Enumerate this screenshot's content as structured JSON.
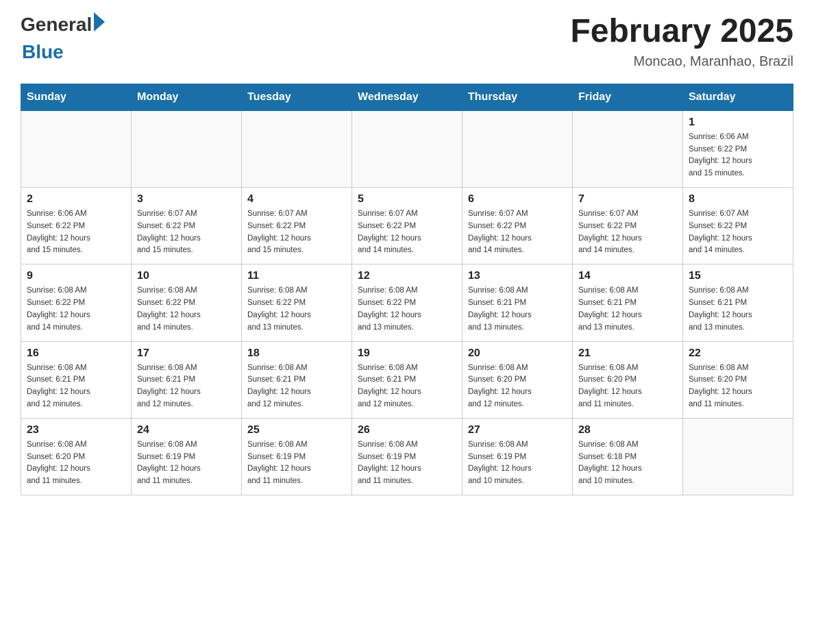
{
  "logo": {
    "general": "General",
    "blue": "Blue"
  },
  "title": "February 2025",
  "subtitle": "Moncao, Maranhao, Brazil",
  "weekdays": [
    "Sunday",
    "Monday",
    "Tuesday",
    "Wednesday",
    "Thursday",
    "Friday",
    "Saturday"
  ],
  "weeks": [
    [
      {
        "day": "",
        "info": ""
      },
      {
        "day": "",
        "info": ""
      },
      {
        "day": "",
        "info": ""
      },
      {
        "day": "",
        "info": ""
      },
      {
        "day": "",
        "info": ""
      },
      {
        "day": "",
        "info": ""
      },
      {
        "day": "1",
        "info": "Sunrise: 6:06 AM\nSunset: 6:22 PM\nDaylight: 12 hours\nand 15 minutes."
      }
    ],
    [
      {
        "day": "2",
        "info": "Sunrise: 6:06 AM\nSunset: 6:22 PM\nDaylight: 12 hours\nand 15 minutes."
      },
      {
        "day": "3",
        "info": "Sunrise: 6:07 AM\nSunset: 6:22 PM\nDaylight: 12 hours\nand 15 minutes."
      },
      {
        "day": "4",
        "info": "Sunrise: 6:07 AM\nSunset: 6:22 PM\nDaylight: 12 hours\nand 15 minutes."
      },
      {
        "day": "5",
        "info": "Sunrise: 6:07 AM\nSunset: 6:22 PM\nDaylight: 12 hours\nand 14 minutes."
      },
      {
        "day": "6",
        "info": "Sunrise: 6:07 AM\nSunset: 6:22 PM\nDaylight: 12 hours\nand 14 minutes."
      },
      {
        "day": "7",
        "info": "Sunrise: 6:07 AM\nSunset: 6:22 PM\nDaylight: 12 hours\nand 14 minutes."
      },
      {
        "day": "8",
        "info": "Sunrise: 6:07 AM\nSunset: 6:22 PM\nDaylight: 12 hours\nand 14 minutes."
      }
    ],
    [
      {
        "day": "9",
        "info": "Sunrise: 6:08 AM\nSunset: 6:22 PM\nDaylight: 12 hours\nand 14 minutes."
      },
      {
        "day": "10",
        "info": "Sunrise: 6:08 AM\nSunset: 6:22 PM\nDaylight: 12 hours\nand 14 minutes."
      },
      {
        "day": "11",
        "info": "Sunrise: 6:08 AM\nSunset: 6:22 PM\nDaylight: 12 hours\nand 13 minutes."
      },
      {
        "day": "12",
        "info": "Sunrise: 6:08 AM\nSunset: 6:22 PM\nDaylight: 12 hours\nand 13 minutes."
      },
      {
        "day": "13",
        "info": "Sunrise: 6:08 AM\nSunset: 6:21 PM\nDaylight: 12 hours\nand 13 minutes."
      },
      {
        "day": "14",
        "info": "Sunrise: 6:08 AM\nSunset: 6:21 PM\nDaylight: 12 hours\nand 13 minutes."
      },
      {
        "day": "15",
        "info": "Sunrise: 6:08 AM\nSunset: 6:21 PM\nDaylight: 12 hours\nand 13 minutes."
      }
    ],
    [
      {
        "day": "16",
        "info": "Sunrise: 6:08 AM\nSunset: 6:21 PM\nDaylight: 12 hours\nand 12 minutes."
      },
      {
        "day": "17",
        "info": "Sunrise: 6:08 AM\nSunset: 6:21 PM\nDaylight: 12 hours\nand 12 minutes."
      },
      {
        "day": "18",
        "info": "Sunrise: 6:08 AM\nSunset: 6:21 PM\nDaylight: 12 hours\nand 12 minutes."
      },
      {
        "day": "19",
        "info": "Sunrise: 6:08 AM\nSunset: 6:21 PM\nDaylight: 12 hours\nand 12 minutes."
      },
      {
        "day": "20",
        "info": "Sunrise: 6:08 AM\nSunset: 6:20 PM\nDaylight: 12 hours\nand 12 minutes."
      },
      {
        "day": "21",
        "info": "Sunrise: 6:08 AM\nSunset: 6:20 PM\nDaylight: 12 hours\nand 11 minutes."
      },
      {
        "day": "22",
        "info": "Sunrise: 6:08 AM\nSunset: 6:20 PM\nDaylight: 12 hours\nand 11 minutes."
      }
    ],
    [
      {
        "day": "23",
        "info": "Sunrise: 6:08 AM\nSunset: 6:20 PM\nDaylight: 12 hours\nand 11 minutes."
      },
      {
        "day": "24",
        "info": "Sunrise: 6:08 AM\nSunset: 6:19 PM\nDaylight: 12 hours\nand 11 minutes."
      },
      {
        "day": "25",
        "info": "Sunrise: 6:08 AM\nSunset: 6:19 PM\nDaylight: 12 hours\nand 11 minutes."
      },
      {
        "day": "26",
        "info": "Sunrise: 6:08 AM\nSunset: 6:19 PM\nDaylight: 12 hours\nand 11 minutes."
      },
      {
        "day": "27",
        "info": "Sunrise: 6:08 AM\nSunset: 6:19 PM\nDaylight: 12 hours\nand 10 minutes."
      },
      {
        "day": "28",
        "info": "Sunrise: 6:08 AM\nSunset: 6:18 PM\nDaylight: 12 hours\nand 10 minutes."
      },
      {
        "day": "",
        "info": ""
      }
    ]
  ]
}
